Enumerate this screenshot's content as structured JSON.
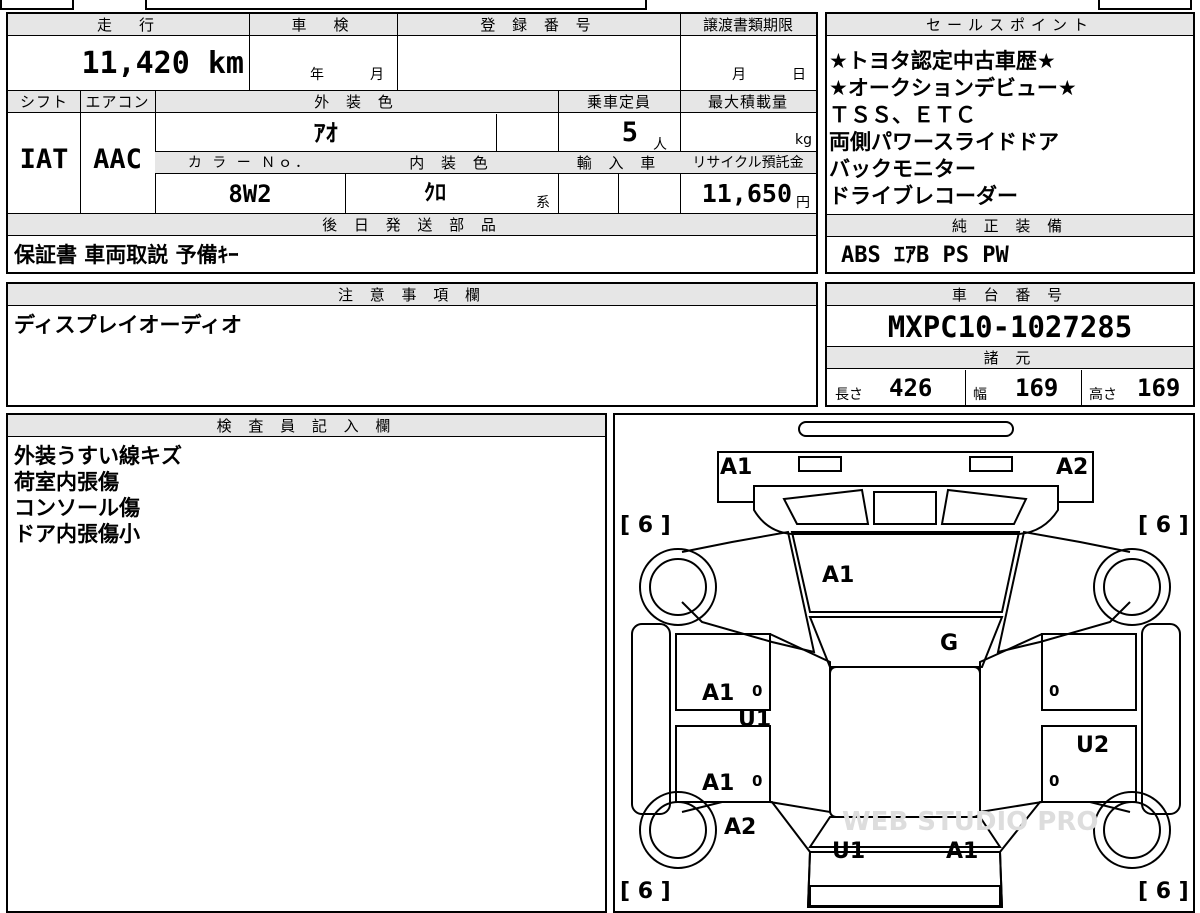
{
  "vehicle": {
    "mileage_label": "走　行",
    "mileage": "11,420 km",
    "inspection_label": "車　検",
    "inspection_year": "年",
    "inspection_month": "月",
    "registration_label": "登 録 番 号",
    "transfer_deadline_label": "譲渡書類期限",
    "transfer_month": "月",
    "transfer_day": "日",
    "shift_label": "シフト",
    "shift": "IAT",
    "ac_label": "エアコン",
    "ac": "AAC",
    "exterior_color_label": "外 装 色",
    "exterior_color": "ｱｵ",
    "capacity_label": "乗車定員",
    "capacity": "5",
    "capacity_unit": "人",
    "max_load_label": "最大積載量",
    "max_load_unit": "kg",
    "color_no_label": "カ ラ ー Ｎｏ．",
    "color_no": "8W2",
    "interior_color_label": "内 装 色",
    "interior_color": "ｸﾛ",
    "interior_suffix": "系",
    "import_label": "輸 入 車",
    "recycle_label": "リサイクル預託金",
    "recycle_fee": "11,650",
    "recycle_unit": "円"
  },
  "sales_points": {
    "label": "セールスポイント",
    "lines": [
      "★トヨタ認定中古車歴★",
      "★オークションデビュー★",
      "ＴＳＳ、ＥＴＣ",
      "両側パワースライドドア",
      "バックモニター",
      "ドライブレコーダー"
    ]
  },
  "delivery": {
    "label": "後 日 発 送 部 品",
    "items": "保証書 車両取説 予備ｷｰ"
  },
  "equipment": {
    "label": "純 正 装 備",
    "items": "ABS ｴｱB PS PW"
  },
  "notes": {
    "label": "注 意 事 項 欄",
    "text": "ディスプレイオーディオ"
  },
  "chassis": {
    "label": "車 台 番 号",
    "number": "MXPC10-1027285"
  },
  "specs": {
    "label": "諸 元",
    "length_label": "長さ",
    "length": "426",
    "width_label": "幅",
    "width": "169",
    "height_label": "高さ",
    "height": "169"
  },
  "inspector": {
    "label": "検 査 員 記 入 欄",
    "lines": [
      "外装うすい線キズ",
      "荷室内張傷",
      "コンソール傷",
      "ドア内張傷小"
    ]
  },
  "diagram": {
    "tire_tl": "[ 6 ]",
    "tire_tr": "[ 6 ]",
    "tire_bl": "[ 6 ]",
    "tire_br": "[ 6 ]",
    "bumper_front_left": "A1",
    "bumper_front_right": "A2",
    "hood": "A1",
    "windshield": "G",
    "front_door_left": "A1",
    "front_door_left_num": "0",
    "left_side": "U1",
    "rear_door_left": "A1",
    "rear_door_left_num": "0",
    "rear_fender_left": "A2",
    "right_front_num": "0",
    "right_side": "U2",
    "right_rear_num": "0",
    "tailgate_left": "U1",
    "tailgate_right": "A1",
    "watermark": "WEB STUDIO PRO"
  }
}
